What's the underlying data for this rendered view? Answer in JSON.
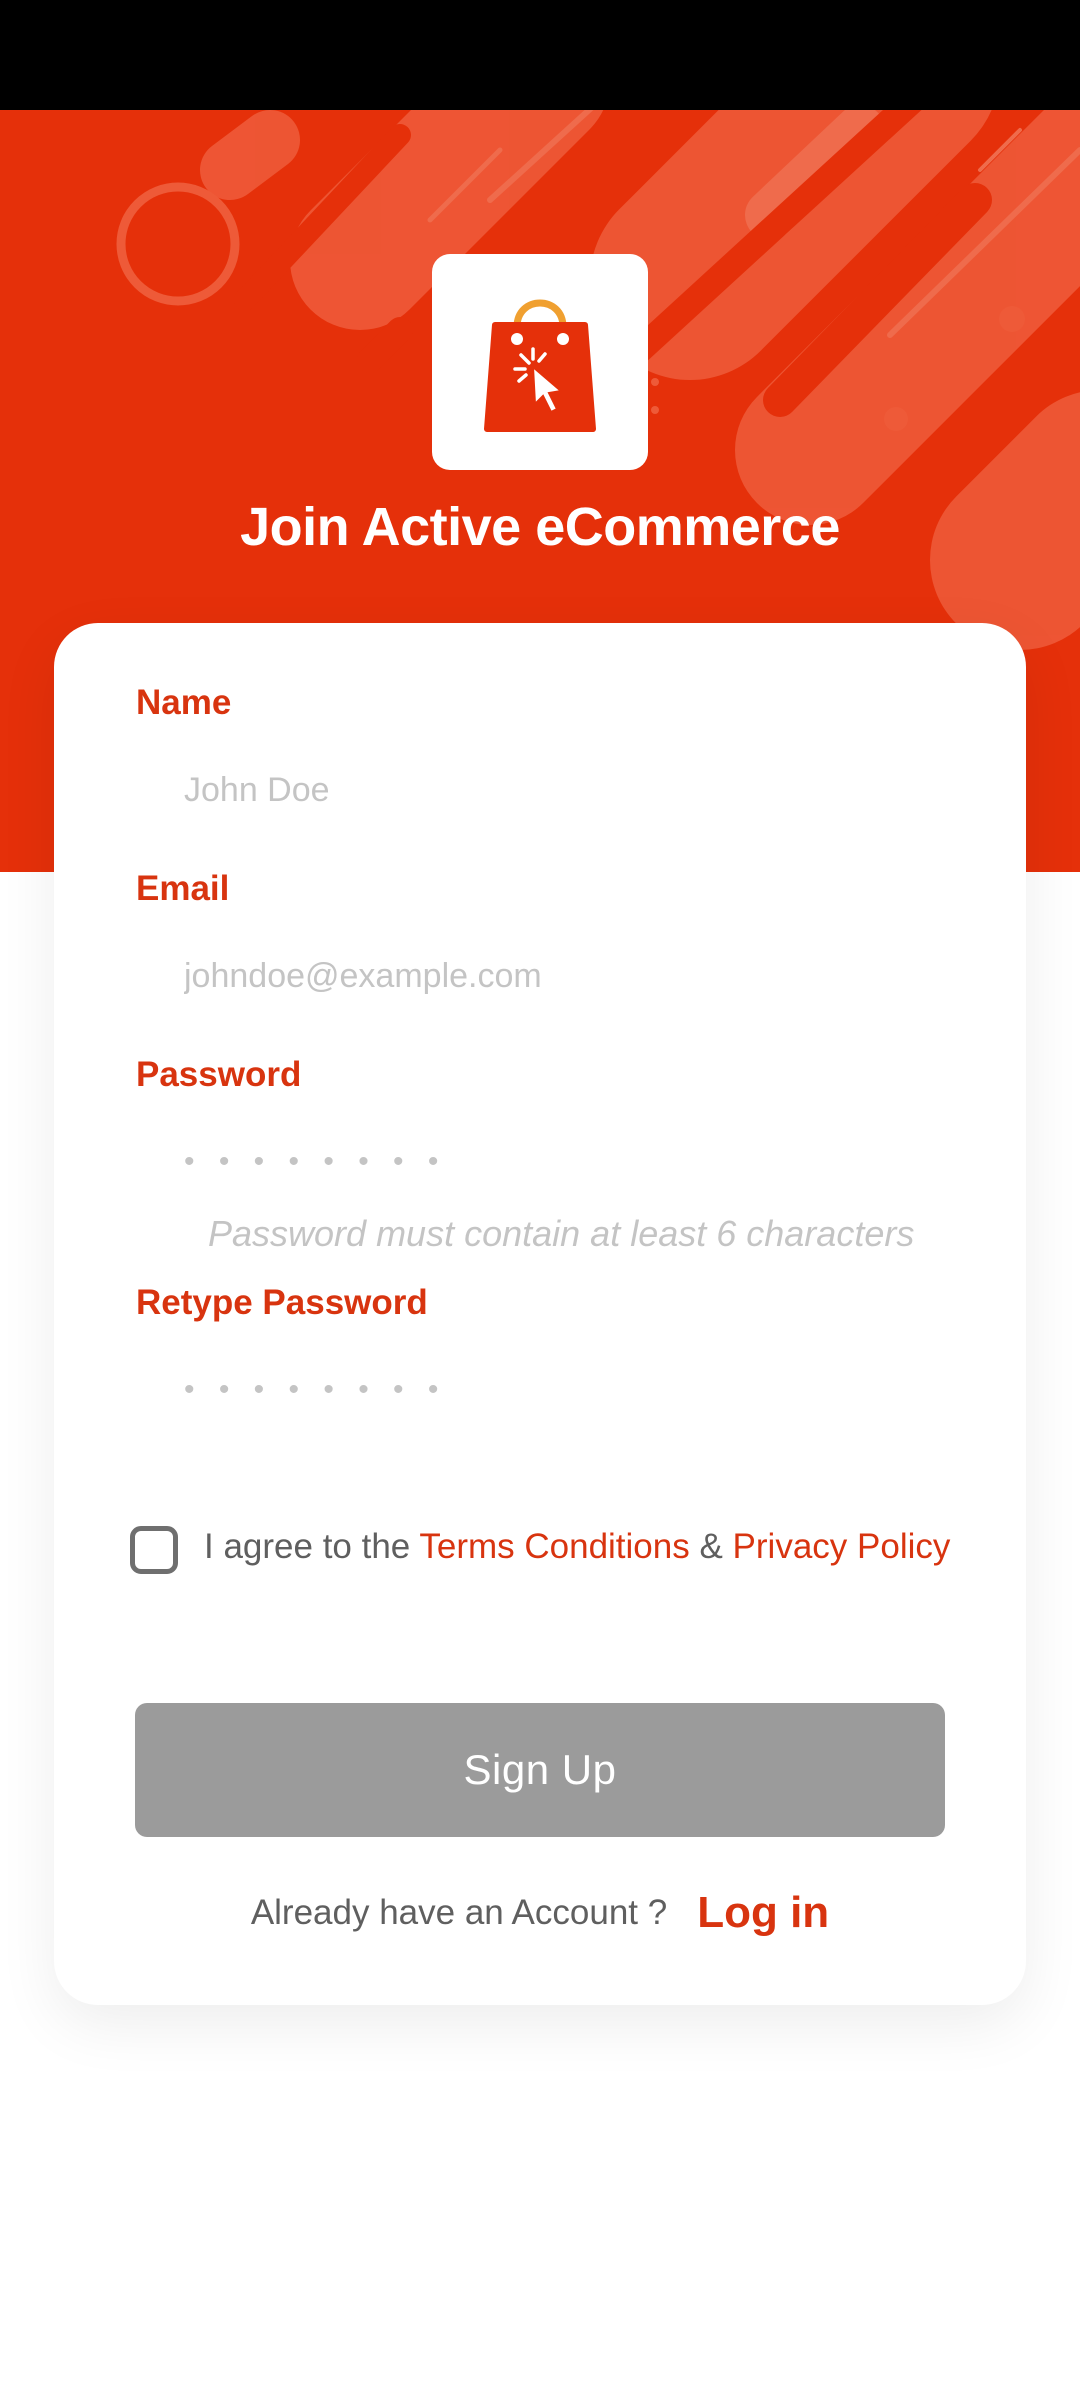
{
  "header": {
    "title": "Join Active eCommerce"
  },
  "form": {
    "name": {
      "label": "Name",
      "placeholder": "John Doe"
    },
    "email": {
      "label": "Email",
      "placeholder": "johndoe@example.com"
    },
    "password": {
      "label": "Password",
      "placeholder": "• • • • • • • •",
      "hint": "Password must contain at least 6 characters"
    },
    "retype": {
      "label": "Retype Password",
      "placeholder": "• • • • • • • •"
    },
    "agree": {
      "prefix": "I agree to the ",
      "terms": "Terms Conditions",
      "amp": " & ",
      "privacy": "Privacy Policy",
      "checked": false
    },
    "signup_label": "Sign Up",
    "footer": {
      "text": "Already have an Account ?",
      "login": "Log in"
    }
  },
  "colors": {
    "brand": "#e5300a",
    "label": "#d8340f",
    "button_disabled": "#9b9b9b"
  },
  "icons": {
    "logo": "shopping-bag-cursor-icon"
  }
}
